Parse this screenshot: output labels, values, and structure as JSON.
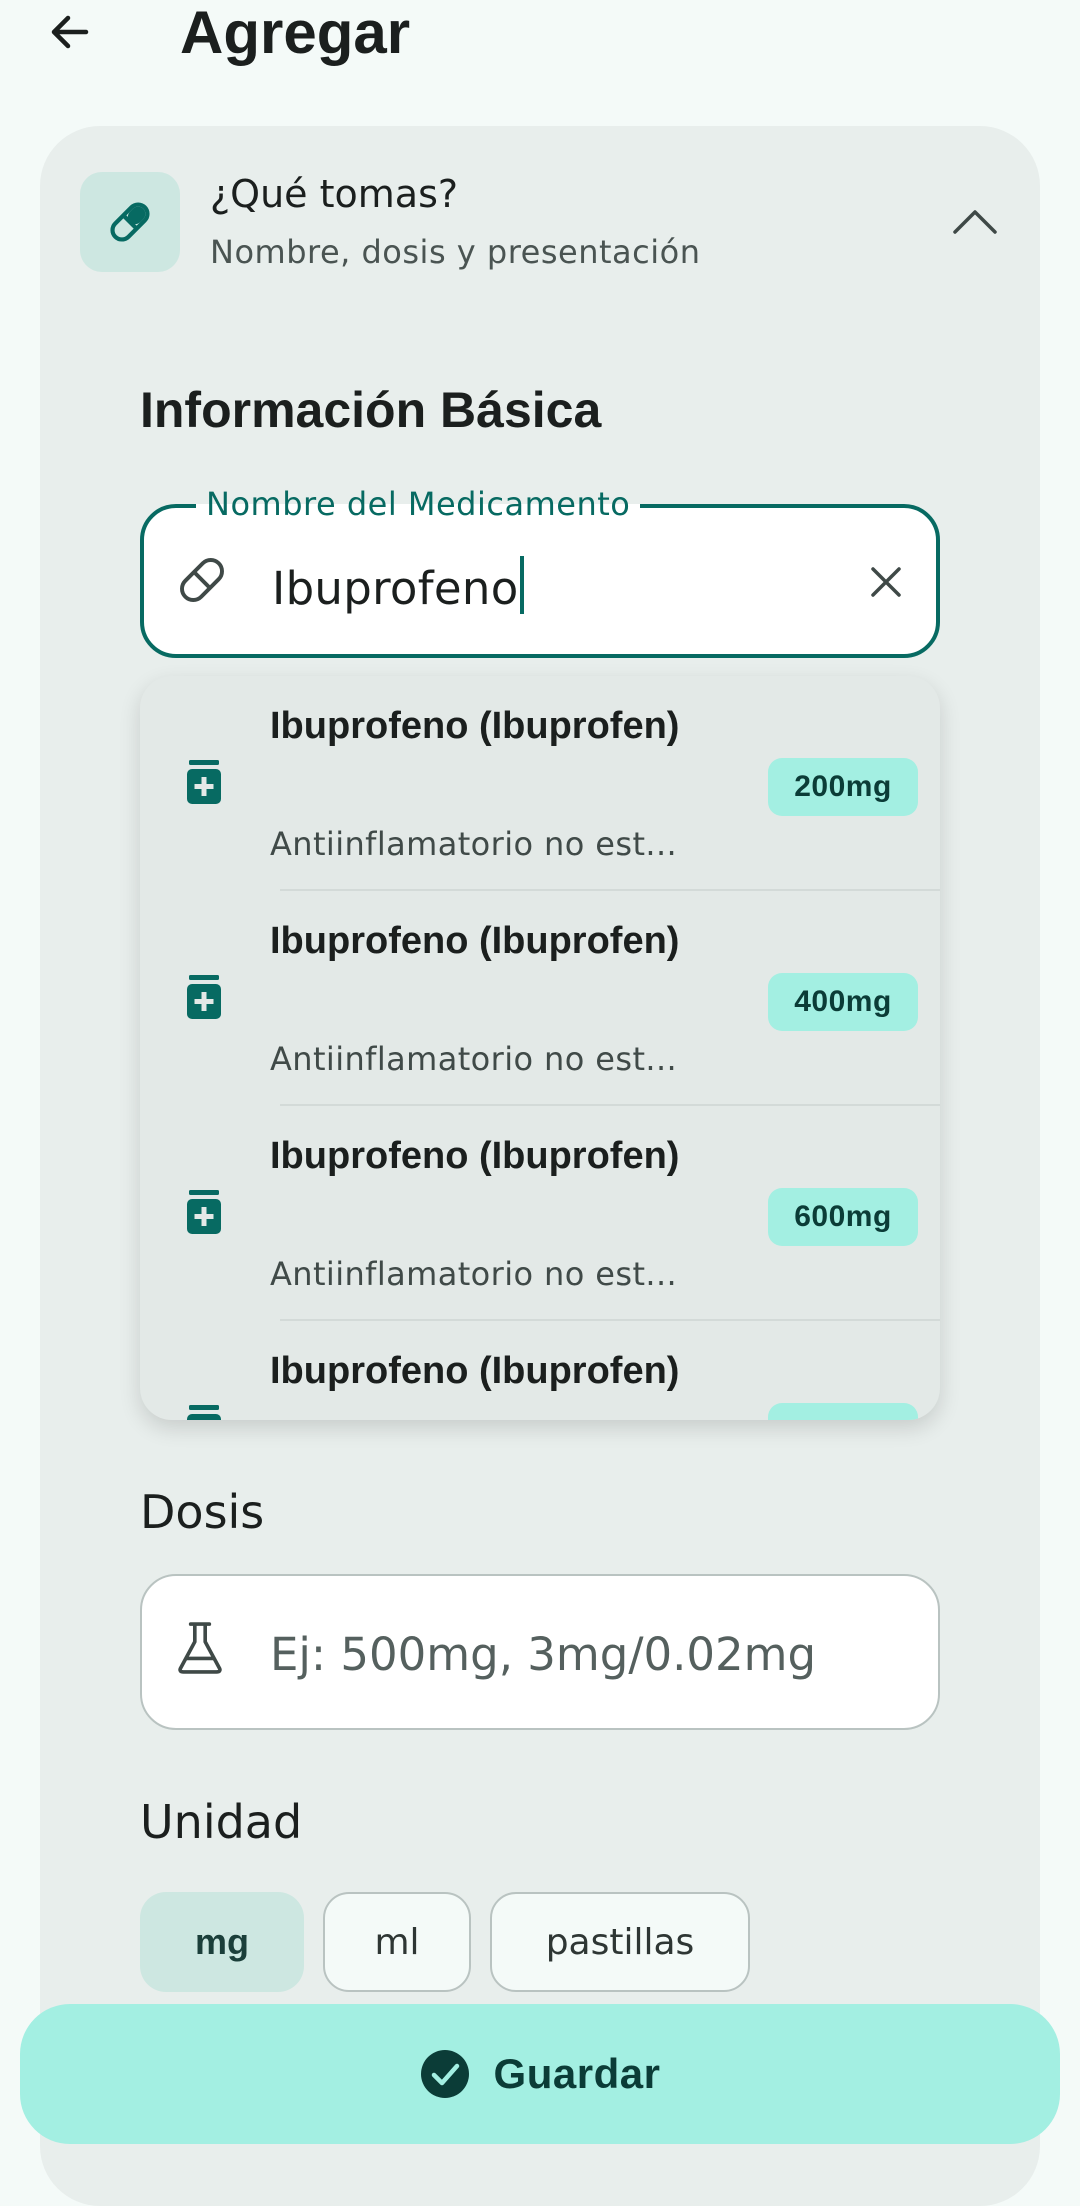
{
  "header": {
    "title": "Agregar",
    "back_icon": "arrow-left-icon"
  },
  "section_card": {
    "title": "¿Qué tomas?",
    "subtitle": "Nombre, dosis y presentación",
    "icon": "pill-icon",
    "expanded": true
  },
  "basic_info": {
    "title": "Información Básica",
    "name_field": {
      "label": "Nombre del Medicamento",
      "value": "Ibuprofeno",
      "clear_icon": "close-icon"
    }
  },
  "suggestions": [
    {
      "name": "Ibuprofeno (Ibuprofen)",
      "description": "Antiinflamatorio no est...",
      "dose": "200mg"
    },
    {
      "name": "Ibuprofeno (Ibuprofen)",
      "description": "Antiinflamatorio no est...",
      "dose": "400mg"
    },
    {
      "name": "Ibuprofeno (Ibuprofen)",
      "description": "Antiinflamatorio no est...",
      "dose": "600mg"
    },
    {
      "name": "Ibuprofeno (Ibuprofen)",
      "description": "",
      "dose": ""
    }
  ],
  "dose": {
    "label": "Dosis",
    "placeholder": "Ej: 500mg, 3mg/0.02mg",
    "value": ""
  },
  "unit": {
    "label": "Unidad",
    "options": [
      "mg",
      "ml",
      "pastillas"
    ],
    "selected": "mg"
  },
  "save_button": {
    "label": "Guardar"
  },
  "colors": {
    "primary": "#076a62",
    "accent_container": "#a3efe2",
    "surface": "#e8eeec",
    "background": "#f4faf8"
  }
}
